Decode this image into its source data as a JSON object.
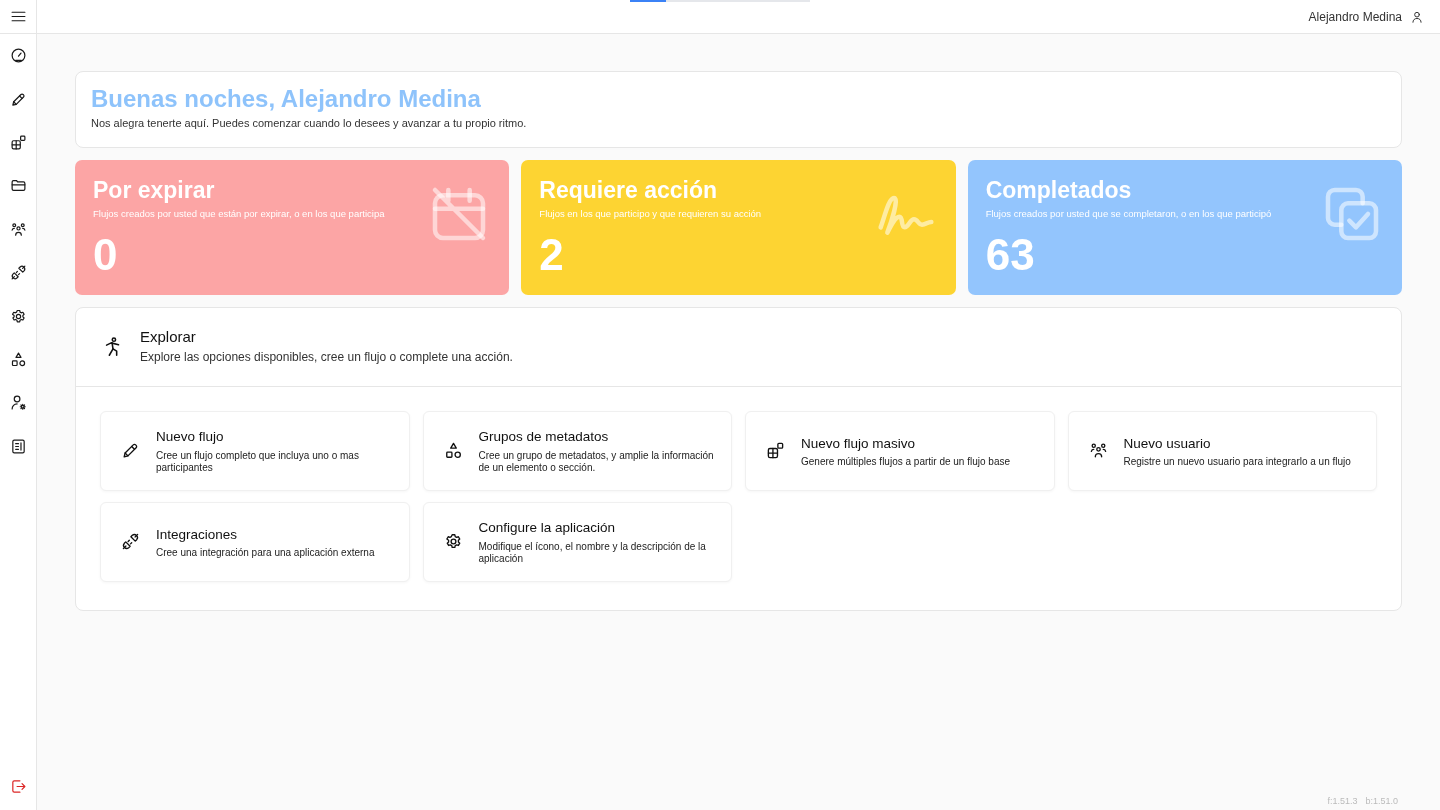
{
  "loading_bar": {
    "level": 0.2
  },
  "topbar": {
    "user_name": "Alejandro Medina"
  },
  "greeting": {
    "title": "Buenas noches, Alejandro Medina",
    "subtitle": "Nos alegra tenerte aquí. Puedes comenzar cuando lo desees y avanzar a tu propio ritmo."
  },
  "stat_cards": [
    {
      "title": "Por expirar",
      "description": "Flujos creados por usted que están por expirar, o en los que participa",
      "count": "0",
      "color": "#fca5a5"
    },
    {
      "title": "Requiere acción",
      "description": "Flujos en los que participo y que requieren su acción",
      "count": "2",
      "color": "#fdd432"
    },
    {
      "title": "Completados",
      "description": "Flujos creados por usted que se completaron, o en los que participó",
      "count": "63",
      "color": "#93c5fd"
    }
  ],
  "explore": {
    "title": "Explorar",
    "subtitle": "Explore las opciones disponibles, cree un flujo o complete una acción.",
    "options": [
      {
        "title": "Nuevo flujo",
        "description": "Cree un flujo completo que incluya uno o mas participantes"
      },
      {
        "title": "Grupos de metadatos",
        "description": "Cree un grupo de metadatos, y amplie la información de un elemento o sección."
      },
      {
        "title": "Nuevo flujo masivo",
        "description": "Genere múltiples flujos a partir de un flujo base"
      },
      {
        "title": "Nuevo usuario",
        "description": "Registre un nuevo usuario para integrarlo a un flujo"
      },
      {
        "title": "Integraciones",
        "description": "Cree una integración para una aplicación externa"
      },
      {
        "title": "Configure la aplicación",
        "description": "Modifique el ícono, el nombre y la descripción de la aplicación"
      }
    ]
  },
  "version": {
    "frontend": "f:1.51.3",
    "backend": "b:1.51.0"
  }
}
